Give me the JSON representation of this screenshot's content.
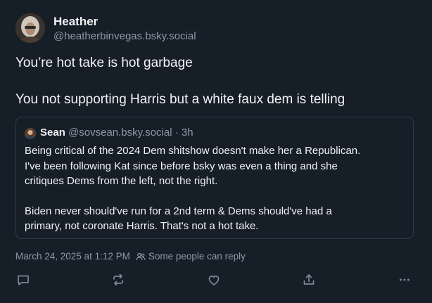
{
  "post": {
    "author": {
      "display_name": "Heather",
      "handle": "@heatherbinvegas.bsky.social"
    },
    "text_lines": [
      "You’re hot take is hot garbage",
      "You not supporting Harris but a white faux dem is telling"
    ],
    "quote": {
      "author_name": "Sean",
      "author_handle": "@sovsean.bsky.social",
      "separator": "·",
      "time": "3h",
      "lines": [
        "Being critical of the 2024 Dem shitshow doesn't make her a Republican.",
        "I've been following Kat since before bsky was even a thing and she",
        "critiques Dems from the left, not the right.",
        "Biden never should've run for a 2nd term & Dems should've had a",
        "primary, not coronate Harris. That's not a hot take."
      ]
    },
    "timestamp": "March 24, 2025 at 1:12 PM",
    "reply_setting": "Some people can reply"
  },
  "actions": {
    "reply_icon": "speech-bubble-icon",
    "repost_icon": "repost-arrows-icon",
    "like_icon": "heart-icon",
    "share_icon": "share-upload-icon",
    "more_icon": "ellipsis-icon"
  },
  "colors": {
    "background": "#161e27",
    "text_primary": "#f1f3f5",
    "text_secondary": "#8d9aa8",
    "border": "#2e3b4a",
    "icon": "#788a9e"
  }
}
